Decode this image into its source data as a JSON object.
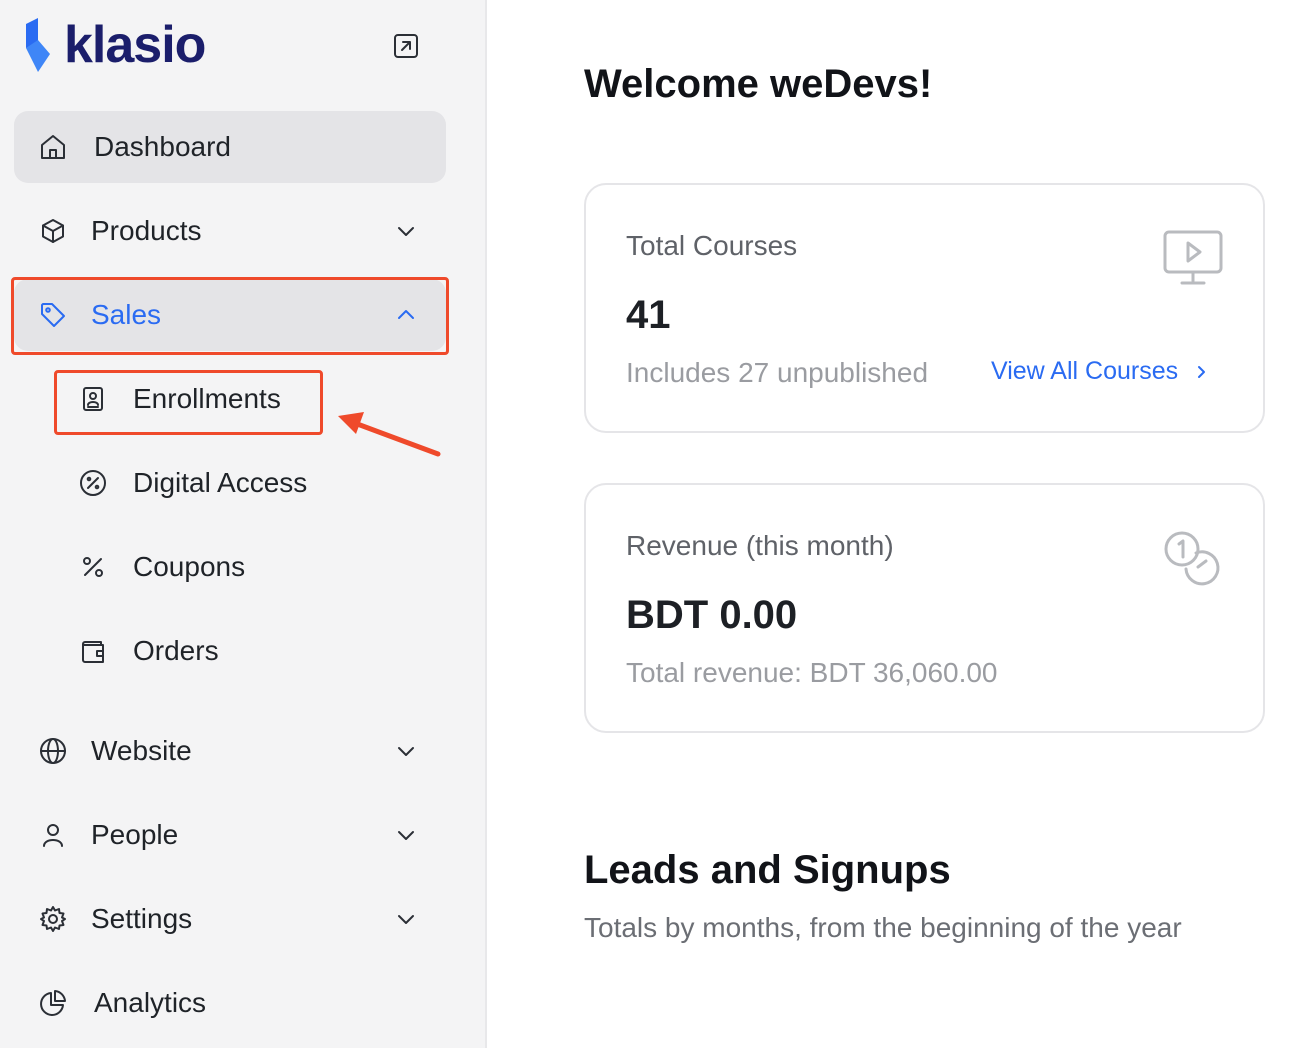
{
  "brand": {
    "name": "klasio",
    "accent": "#2a6bf2",
    "dark": "#1b1e6b"
  },
  "sidebar": {
    "items": [
      {
        "label": "Dashboard",
        "icon": "home-icon"
      },
      {
        "label": "Products",
        "icon": "box-icon"
      },
      {
        "label": "Sales",
        "icon": "tag-icon"
      },
      {
        "label": "Website",
        "icon": "globe-icon"
      },
      {
        "label": "People",
        "icon": "user-icon"
      },
      {
        "label": "Settings",
        "icon": "gear-icon"
      },
      {
        "label": "Analytics",
        "icon": "pie-chart-icon"
      }
    ],
    "sales_sub": [
      {
        "label": "Enrollments",
        "icon": "id-badge-icon"
      },
      {
        "label": "Digital Access",
        "icon": "percent-circle-icon"
      },
      {
        "label": "Coupons",
        "icon": "percent-icon"
      },
      {
        "label": "Orders",
        "icon": "wallet-icon"
      }
    ]
  },
  "main": {
    "welcome": "Welcome weDevs!",
    "courses_card": {
      "title": "Total Courses",
      "value": "41",
      "sub": "Includes 27 unpublished",
      "link": "View All Courses"
    },
    "revenue_card": {
      "title": "Revenue (this month)",
      "value": "BDT 0.00",
      "sub": "Total revenue: BDT 36,060.00"
    },
    "leads": {
      "title": "Leads and Signups",
      "subtitle": "Totals by months, from the beginning of the year"
    }
  },
  "colors": {
    "highlight": "#ef4a2b"
  }
}
